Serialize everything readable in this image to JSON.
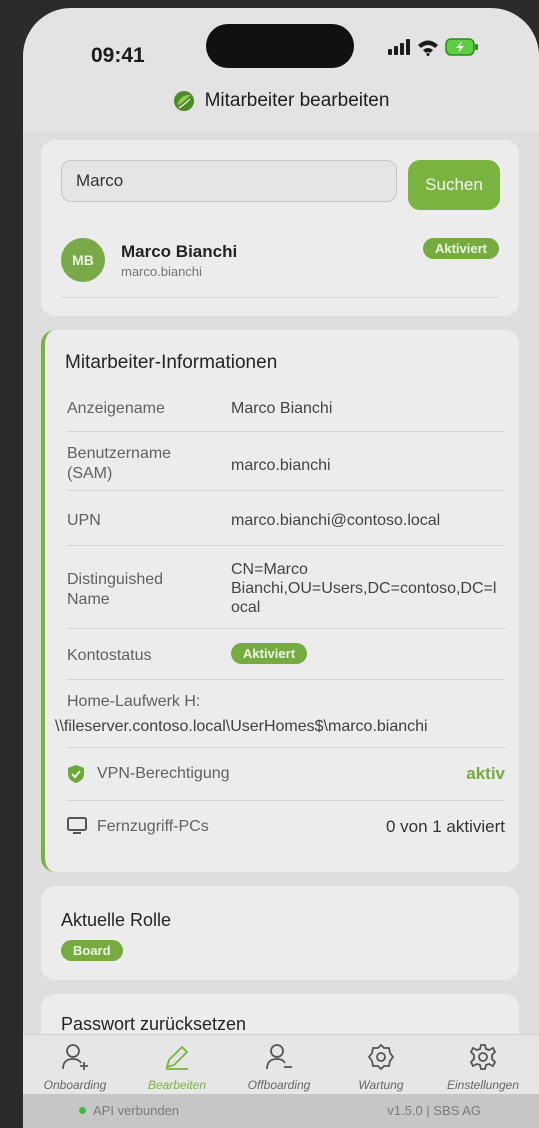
{
  "status_bar": {
    "time": "09:41"
  },
  "header": {
    "title": "Mitarbeiter bearbeiten"
  },
  "search": {
    "value": "Marco",
    "button_label": "Suchen"
  },
  "result": {
    "initials": "MB",
    "name": "Marco Bianchi",
    "username": "marco.bianchi",
    "status": "Aktiviert"
  },
  "info": {
    "title": "Mitarbeiter-Informationen",
    "display_name_label": "Anzeigename",
    "display_name": "Marco Bianchi",
    "sam_label_1": "Benutzername",
    "sam_label_2": "(SAM)",
    "sam": "marco.bianchi",
    "upn_label": "UPN",
    "upn": "marco.bianchi@contoso.local",
    "dn_label_1": "Distinguished",
    "dn_label_2": "Name",
    "dn_1": "CN=Marco",
    "dn_2": "Bianchi,OU=Users,DC=contoso,DC=l",
    "dn_3": "ocal",
    "account_status_label": "Kontostatus",
    "account_status": "Aktiviert",
    "home_label": "Home-Laufwerk H:",
    "home_path": "\\\\fileserver.contoso.local\\UserHomes$\\marco.bianchi",
    "vpn_label": "VPN-Berechtigung",
    "vpn_value": "aktiv",
    "remote_label": "Fernzugriff-PCs",
    "remote_value": "0 von 1 aktiviert"
  },
  "role": {
    "title": "Aktuelle Rolle",
    "value": "Board"
  },
  "password": {
    "title": "Passwort zurücksetzen"
  },
  "nav": {
    "onboarding": "Onboarding",
    "edit": "Bearbeiten",
    "offboarding": "Offboarding",
    "maintenance": "Wartung",
    "settings": "Einstellungen"
  },
  "footer": {
    "api_status": "API verbunden",
    "version": "v1.5.0 | SBS AG"
  },
  "colors": {
    "accent": "#7ab33f",
    "status_green": "#3dbb45"
  }
}
